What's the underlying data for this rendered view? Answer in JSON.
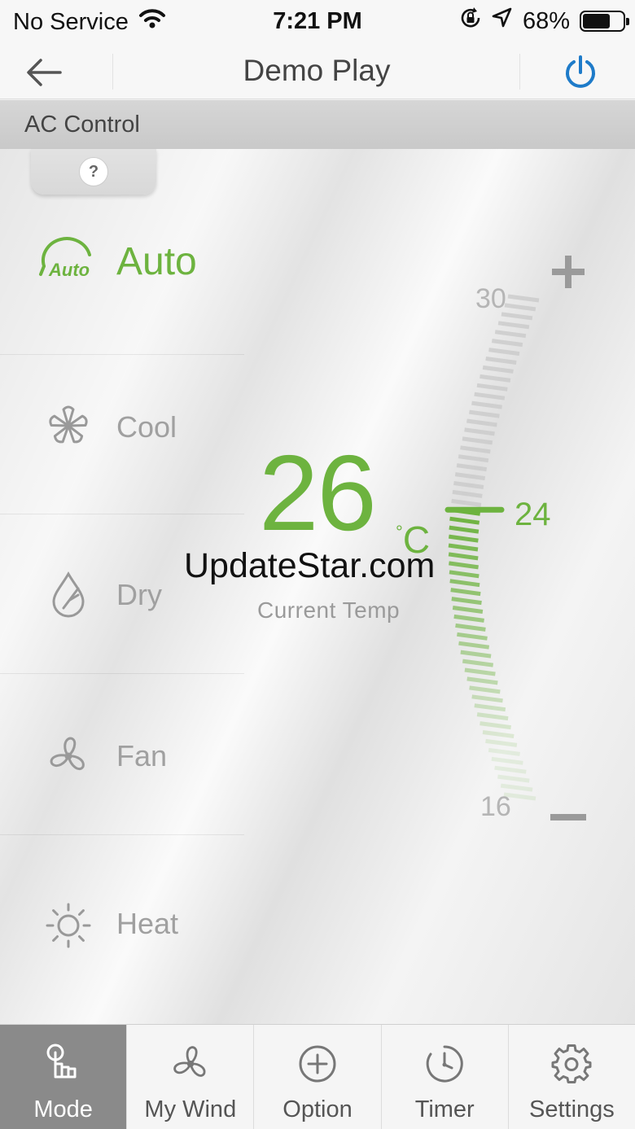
{
  "status_bar": {
    "carrier": "No Service",
    "time": "7:21 PM",
    "battery": "68%",
    "battery_level": 0.68
  },
  "nav": {
    "title": "Demo Play",
    "back_icon": "back-arrow-icon",
    "power_icon": "power-icon"
  },
  "section": {
    "title": "AC Control",
    "help_label": "?"
  },
  "modes": [
    {
      "label": "Auto",
      "icon": "auto-icon",
      "active": true
    },
    {
      "label": "Cool",
      "icon": "snowflake-icon",
      "active": false
    },
    {
      "label": "Dry",
      "icon": "drop-icon",
      "active": false
    },
    {
      "label": "Fan",
      "icon": "fan-icon",
      "active": false
    },
    {
      "label": "Heat",
      "icon": "sun-icon",
      "active": false
    }
  ],
  "auto_icon_text": "Auto",
  "temperature": {
    "current": "26",
    "unit": "C",
    "current_label": "Current Temp",
    "setpoint": "24",
    "max": "30",
    "min": "16"
  },
  "watermark": "UpdateStar.com",
  "tabs": [
    {
      "label": "Mode",
      "icon": "hand-pointer-icon",
      "active": true
    },
    {
      "label": "My Wind",
      "icon": "fan-icon",
      "active": false
    },
    {
      "label": "Option",
      "icon": "plus-circle-icon",
      "active": false
    },
    {
      "label": "Timer",
      "icon": "timer-icon",
      "active": false
    },
    {
      "label": "Settings",
      "icon": "gear-icon",
      "active": false
    }
  ],
  "colors": {
    "accent": "#6db33f",
    "power_blue": "#1e7bc9",
    "tab_active": "#8a8a8a"
  }
}
